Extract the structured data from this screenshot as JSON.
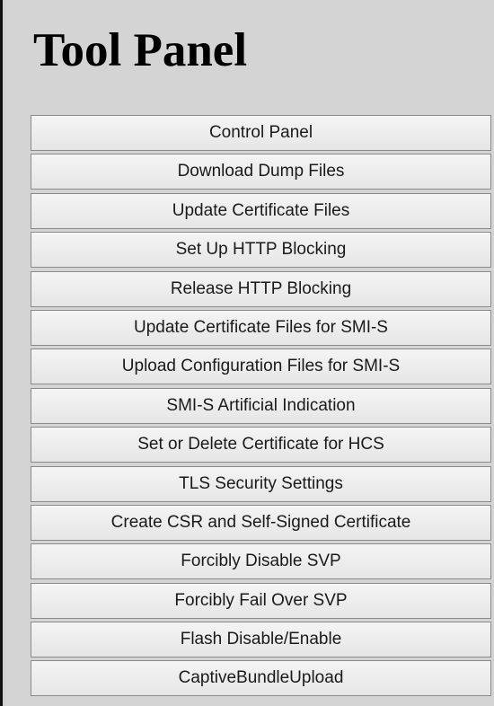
{
  "panel": {
    "title": "Tool Panel",
    "buttons": [
      "Control Panel",
      "Download Dump Files",
      "Update Certificate Files",
      "Set Up HTTP Blocking",
      "Release HTTP Blocking",
      "Update Certificate Files for SMI-S",
      "Upload Configuration Files for SMI-S",
      "SMI-S Artificial Indication",
      "Set or Delete Certificate for HCS",
      "TLS Security Settings",
      "Create CSR and Self-Signed Certificate",
      "Forcibly Disable SVP",
      "Forcibly Fail Over SVP",
      "Flash Disable/Enable",
      "CaptiveBundleUpload"
    ]
  }
}
